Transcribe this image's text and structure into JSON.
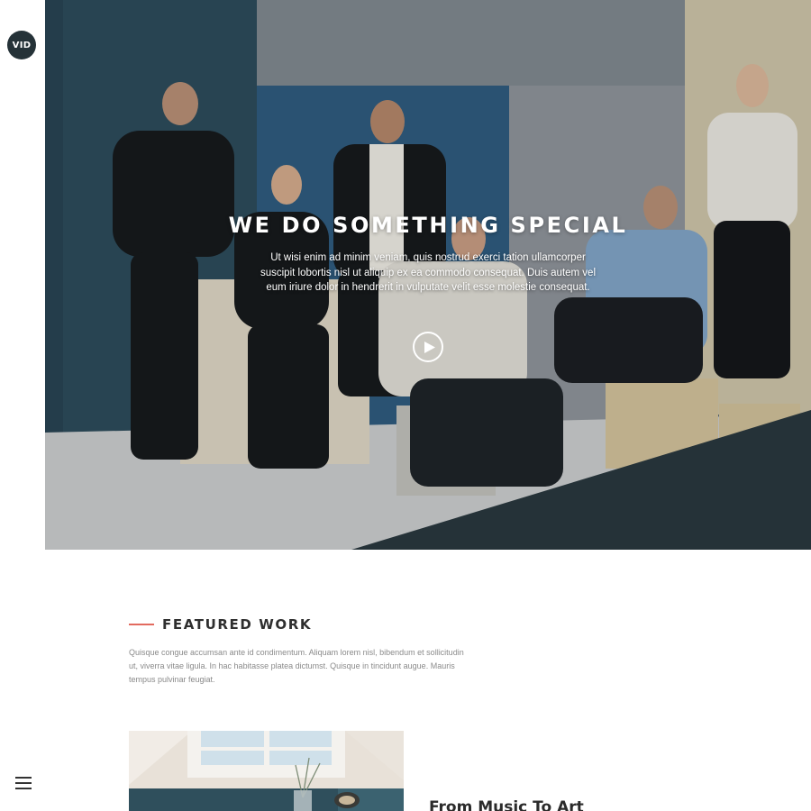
{
  "brand": {
    "logo_text": "VID"
  },
  "hero": {
    "title": "WE DO SOMETHING SPECIAL",
    "description": "Ut wisi enim ad minim veniam, quis nostrud exerci tation ullamcorper suscipit lobortis nisl ut aliquip ex ea commodo consequat. Duis autem vel eum iriure dolor in hendrerit in vulputate velit esse molestie consequat."
  },
  "featured": {
    "title": "FEATURED WORK",
    "description": "Quisque congue accumsan ante id condimentum. Aliquam lorem nisl, bibendum et sollicitudin ut, viverra vitae ligula. In hac habitasse platea dictumst. Quisque in tincidunt augue. Mauris tempus pulvinar feugiat."
  },
  "project": {
    "title": "From Music To Art"
  },
  "colors": {
    "dark": "#253238",
    "accent": "#e26a5f"
  },
  "icons": {
    "play": "play-icon",
    "menu": "hamburger-menu-icon"
  }
}
